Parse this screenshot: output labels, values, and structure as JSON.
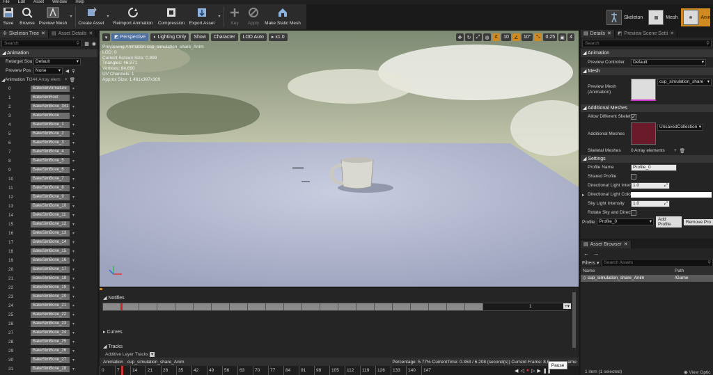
{
  "menu": [
    "File",
    "Edit",
    "Asset",
    "Window",
    "Help"
  ],
  "toolbar": {
    "buttons": [
      {
        "label": "Save",
        "icon": "save-icon"
      },
      {
        "label": "Browse",
        "icon": "browse-icon"
      },
      {
        "label": "Preview Mesh",
        "icon": "preview-mesh-icon"
      },
      {
        "label": "Create Asset",
        "icon": "create-asset-icon"
      },
      {
        "label": "Reimport Animation",
        "icon": "reimport-icon"
      },
      {
        "label": "Compression",
        "icon": "compression-icon"
      },
      {
        "label": "Export Asset",
        "icon": "export-icon"
      },
      {
        "label": "Key",
        "icon": "key-icon"
      },
      {
        "label": "Apply",
        "icon": "apply-icon"
      },
      {
        "label": "Make Static Mesh",
        "icon": "make-static-mesh-icon"
      }
    ]
  },
  "modes": [
    {
      "label": "Skeleton"
    },
    {
      "label": "Mesh"
    },
    {
      "label": "Animation"
    }
  ],
  "left": {
    "tabs": [
      "Skeleton Tree",
      "Asset Details"
    ],
    "search_placeholder": "Search",
    "animation_header": "Animation",
    "retarget_label": "Retarget Sou",
    "retarget_value": "Default",
    "preview_pose_label": "Preview Pos",
    "preview_pose_value": "None",
    "anim_track_label": "Animation Tr",
    "anim_track_value": "344 Array elem",
    "bones": [
      {
        "i": "0",
        "n": "BakeSimArmature"
      },
      {
        "i": "1",
        "n": "BakeSimRoot"
      },
      {
        "i": "2",
        "n": "BakeSimBone_341"
      },
      {
        "i": "3",
        "n": "BakeSimBone"
      },
      {
        "i": "4",
        "n": "BakeSimBone_1"
      },
      {
        "i": "5",
        "n": "BakeSimBone_2"
      },
      {
        "i": "6",
        "n": "BakeSimBone_3"
      },
      {
        "i": "7",
        "n": "BakeSimBone_4"
      },
      {
        "i": "8",
        "n": "BakeSimBone_5"
      },
      {
        "i": "9",
        "n": "BakeSimBone_6"
      },
      {
        "i": "10",
        "n": "BakeSimBone_7"
      },
      {
        "i": "11",
        "n": "BakeSimBone_8"
      },
      {
        "i": "12",
        "n": "BakeSimBone_9"
      },
      {
        "i": "13",
        "n": "BakeSimBone_10"
      },
      {
        "i": "14",
        "n": "BakeSimBone_11"
      },
      {
        "i": "15",
        "n": "BakeSimBone_12"
      },
      {
        "i": "16",
        "n": "BakeSimBone_13"
      },
      {
        "i": "17",
        "n": "BakeSimBone_14"
      },
      {
        "i": "18",
        "n": "BakeSimBone_15"
      },
      {
        "i": "19",
        "n": "BakeSimBone_16"
      },
      {
        "i": "20",
        "n": "BakeSimBone_17"
      },
      {
        "i": "21",
        "n": "BakeSimBone_18"
      },
      {
        "i": "22",
        "n": "BakeSimBone_19"
      },
      {
        "i": "23",
        "n": "BakeSimBone_20"
      },
      {
        "i": "24",
        "n": "BakeSimBone_21"
      },
      {
        "i": "25",
        "n": "BakeSimBone_22"
      },
      {
        "i": "26",
        "n": "BakeSimBone_23"
      },
      {
        "i": "27",
        "n": "BakeSimBone_24"
      },
      {
        "i": "28",
        "n": "BakeSimBone_25"
      },
      {
        "i": "29",
        "n": "BakeSimBone_26"
      },
      {
        "i": "30",
        "n": "BakeSimBone_27"
      },
      {
        "i": "31",
        "n": "BakeSimBone_28"
      }
    ]
  },
  "viewport": {
    "perspective": "Perspective",
    "lighting": "Lighting Only",
    "show": "Show",
    "character": "Character",
    "lod": "LOD Auto",
    "speed": "x1.0",
    "grid_snap": "10",
    "rot_snap": "10°",
    "scale_snap": "0.25",
    "cam_speed": "4",
    "stats": [
      "Previewing Animation cup_simulation_share_Anim",
      "LOD: 0",
      "Current Screen Size: 0.899",
      "Triangles: 46,971",
      "Vertices: 84,690",
      "UV Channels: 1",
      "Approx Size: 1,461x397x309"
    ]
  },
  "timeline": {
    "notifies": "Notifies",
    "notify_track_num": "1",
    "curves": "Curves",
    "tracks": "Tracks",
    "additive": "Additive Layer Tracks",
    "status_anim": "Animation",
    "status_name": "cup_simulation_share_Anim",
    "status_info": "Percentage: 5.77% CurrentTime: 0.358 / 6.208 (second(s)) Current Frame: 8.6",
    "status_tail": "ame",
    "ticks": [
      "0",
      "7",
      "14",
      "21",
      "28",
      "35",
      "42",
      "49",
      "56",
      "63",
      "70",
      "77",
      "84",
      "91",
      "98",
      "105",
      "112",
      "119",
      "126",
      "133",
      "140",
      "147"
    ],
    "pause_tooltip": "Pause"
  },
  "right": {
    "tabs": [
      "Details",
      "Preview Scene Setti"
    ],
    "search_placeholder": "Search",
    "animation_header": "Animation",
    "preview_controller_label": "Preview Controller",
    "preview_controller_value": "Default",
    "mesh_header": "Mesh",
    "preview_mesh_label": "Preview Mesh (Animation)",
    "preview_mesh_value": "cup_simulation_share",
    "additional_header": "Additional Meshes",
    "allow_diff_label": "Allow Different Skelet",
    "additional_meshes_label": "Additional Meshes",
    "additional_meshes_value": "UnsavedCollection",
    "skeletal_meshes_label": "Skeletal Meshes",
    "skeletal_meshes_value": "0 Array elements",
    "settings_header": "Settings",
    "profile_name_label": "Profile Name",
    "profile_name_value": "Profile_0",
    "shared_profile_label": "Shared Profile",
    "dir_light_int_label": "Directional Light Inten",
    "dir_light_int_value": "1.0",
    "dir_light_col_label": "Directional Light Colo",
    "sky_light_label": "Sky Light Intensity",
    "sky_light_value": "1.0",
    "rotate_sky_label": "Rotate Sky and Direct",
    "profile_label": "Profile",
    "profile_value": "Profile_0",
    "add_profile": "Add Profile",
    "remove_profile": "Remove Pro"
  },
  "assets": {
    "tab": "Asset Browser",
    "filters": "Filters",
    "search_placeholder": "Search Assets",
    "col_name": "Name",
    "col_path": "Path",
    "row_name": "cup_simulation_share_Anim",
    "row_path": "/Game",
    "footer": "1 item (1 selected)",
    "view_options": "View Optic"
  }
}
